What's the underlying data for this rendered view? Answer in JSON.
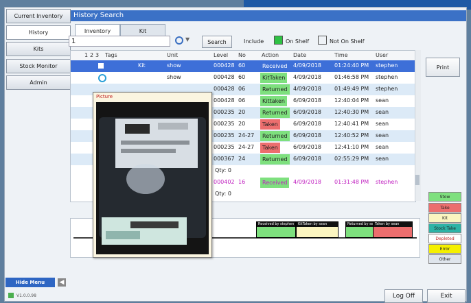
{
  "sidebar": {
    "items": [
      {
        "label": "Current Inventory"
      },
      {
        "label": "History"
      },
      {
        "label": "Kits"
      },
      {
        "label": "Stock Monitor"
      },
      {
        "label": "Admin"
      }
    ],
    "hide_menu": "Hide Menu",
    "version": "V1.0.0.98"
  },
  "header": {
    "title": "History Search"
  },
  "tabs": [
    {
      "label": "Inventory"
    },
    {
      "label": "Kit"
    }
  ],
  "search": {
    "value": "1",
    "button": "Search"
  },
  "include": {
    "label": "Include",
    "on_shelf": "On Shelf",
    "not_on_shelf": "Not On Shelf"
  },
  "print_button": "Print",
  "table": {
    "headers": [
      "1",
      "2",
      "3",
      "Tags",
      "Unit",
      "Level",
      "No",
      "Action",
      "Date",
      "Time",
      "User"
    ],
    "rows": [
      {
        "tag": "Kit",
        "unit": "show",
        "level": "000428",
        "no": "60",
        "action": "Received",
        "date": "4/09/2018",
        "time": "01:24:40 PM",
        "user": "stephen"
      },
      {
        "tag": "",
        "unit": "show",
        "level": "000428",
        "no": "60",
        "action": "KitTaken",
        "date": "4/09/2018",
        "time": "01:46:58 PM",
        "user": "stephen"
      },
      {
        "tag": "",
        "unit": "",
        "level": "000428",
        "no": "06",
        "action": "Returned",
        "date": "4/09/2018",
        "time": "01:49:49 PM",
        "user": "stephen"
      },
      {
        "tag": "",
        "unit": "",
        "level": "000428",
        "no": "06",
        "action": "Kittaken",
        "date": "6/09/2018",
        "time": "12:40:04 PM",
        "user": "sean"
      },
      {
        "tag": "",
        "unit": "",
        "level": "000235",
        "no": "20",
        "action": "Returned",
        "date": "6/09/2018",
        "time": "12:40:30 PM",
        "user": "sean"
      },
      {
        "tag": "",
        "unit": "",
        "level": "000235",
        "no": "20",
        "action": "Taken",
        "date": "6/09/2018",
        "time": "12:40:41 PM",
        "user": "sean"
      },
      {
        "tag": "",
        "unit": "",
        "level": "000235",
        "no": "24-27",
        "action": "Returned",
        "date": "6/09/2018",
        "time": "12:40:52 PM",
        "user": "sean"
      },
      {
        "tag": "",
        "unit": "",
        "level": "000235",
        "no": "24-27",
        "action": "Taken",
        "date": "6/09/2018",
        "time": "12:41:10 PM",
        "user": "sean"
      },
      {
        "tag": "",
        "unit": "",
        "level": "000367",
        "no": "24",
        "action": "Returned",
        "date": "6/09/2018",
        "time": "02:55:29 PM",
        "user": "sean"
      }
    ],
    "qty_row1": "Qty: 0",
    "received_row": {
      "level": "000402",
      "no": "16",
      "action": "Received",
      "date": "4/09/2018",
      "time": "01:31:48 PM",
      "user": "stephen"
    },
    "qty_row2": "Qty: 0"
  },
  "popup": {
    "title": "Picture"
  },
  "flow": {
    "nodes": [
      "Received by stephen",
      "KitTaken by sean",
      "Returned by sean",
      "Taken by sean"
    ]
  },
  "legend": [
    "Stow",
    "Take",
    "Kit",
    "Stock Take",
    "Depleted",
    "Error",
    "Other"
  ],
  "legend_colors": [
    "#7ee07e",
    "#ec6e6e",
    "#fbf5c0",
    "#2fb3a6",
    "#ffffff",
    "#f5f000",
    "#dfe5ec"
  ],
  "footer": {
    "log_off": "Log Off",
    "exit": "Exit"
  }
}
